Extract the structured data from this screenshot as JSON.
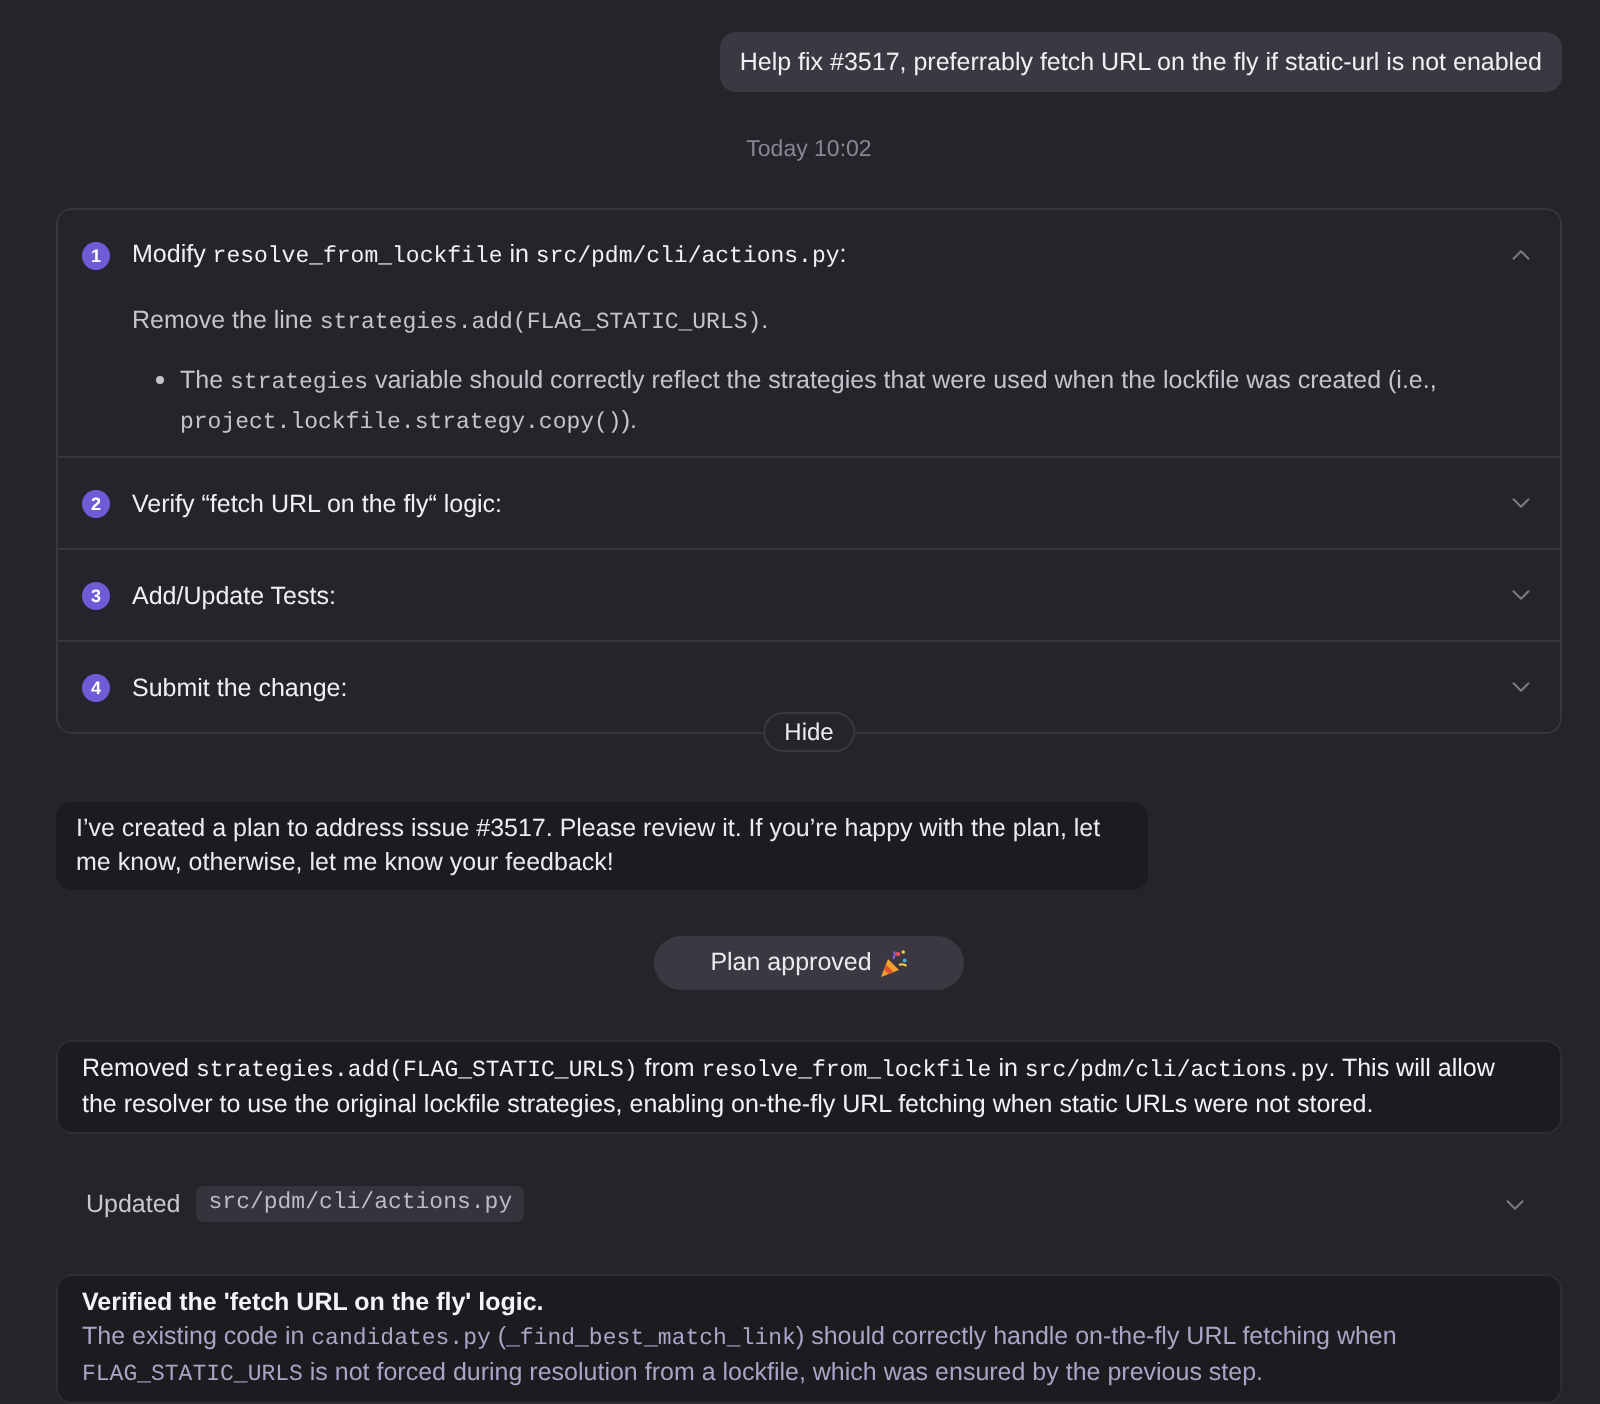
{
  "user_message": {
    "text": "Help fix #3517, preferrably fetch URL on the fly if static-url is not enabled"
  },
  "timestamp": "Today 10:02",
  "plan": {
    "steps": [
      {
        "number": "1",
        "expanded": true,
        "title": [
          {
            "text": "Modify ",
            "kind": "text"
          },
          {
            "text": "resolve_from_lockfile",
            "kind": "code"
          },
          {
            "text": " in ",
            "kind": "text"
          },
          {
            "text": "src/pdm/cli/actions.py",
            "kind": "code"
          },
          {
            "text": ":",
            "kind": "text"
          }
        ],
        "details": {
          "text": [
            {
              "text": "Remove the line ",
              "kind": "text"
            },
            {
              "text": "strategies.add(FLAG_STATIC_URLS)",
              "kind": "code"
            },
            {
              "text": ".",
              "kind": "text"
            }
          ],
          "bullets": [
            [
              {
                "text": "The ",
                "kind": "text"
              },
              {
                "text": "strategies",
                "kind": "code"
              },
              {
                "text": " variable should correctly reflect the strategies that were used when the lockfile was created (i.e., ",
                "kind": "text"
              },
              {
                "text": "project.lockfile.strategy.copy()",
                "kind": "code"
              },
              {
                "text": ").",
                "kind": "text"
              }
            ]
          ]
        }
      },
      {
        "number": "2",
        "expanded": false,
        "title": [
          {
            "text": "Verify “fetch URL on the fly“ logic:",
            "kind": "text"
          }
        ]
      },
      {
        "number": "3",
        "expanded": false,
        "title": [
          {
            "text": "Add/Update Tests:",
            "kind": "text"
          }
        ]
      },
      {
        "number": "4",
        "expanded": false,
        "title": [
          {
            "text": "Submit the change:",
            "kind": "text"
          }
        ]
      }
    ],
    "hide_button": "Hide"
  },
  "assistant_message": {
    "text": "I’ve created a plan to address issue #3517. Please review it. If you’re happy with the plan, let me know, otherwise, let me know your feedback!"
  },
  "approval": {
    "label": "Plan approved"
  },
  "summary": [
    {
      "text": "Removed ",
      "kind": "text"
    },
    {
      "text": "strategies.add(FLAG_STATIC_URLS)",
      "kind": "code"
    },
    {
      "text": " from ",
      "kind": "text"
    },
    {
      "text": "resolve_from_lockfile",
      "kind": "code"
    },
    {
      "text": " in ",
      "kind": "text"
    },
    {
      "text": "src/pdm/cli/actions.py",
      "kind": "code"
    },
    {
      "text": ". This will allow the resolver to use the original lockfile strategies, enabling on-the-fly URL fetching when static URLs were not stored.",
      "kind": "text"
    }
  ],
  "file_update": {
    "label": "Updated",
    "path": "src/pdm/cli/actions.py",
    "expanded": false
  },
  "verification": {
    "title": "Verified the 'fetch URL on the fly' logic.",
    "body": [
      {
        "text": "The existing code in ",
        "kind": "text"
      },
      {
        "text": "candidates.py",
        "kind": "code"
      },
      {
        "text": " (",
        "kind": "text"
      },
      {
        "text": "_find_best_match_link",
        "kind": "code"
      },
      {
        "text": ") should correctly handle on-the-fly URL fetching when ",
        "kind": "text"
      },
      {
        "text": "FLAG_STATIC_URLS",
        "kind": "code"
      },
      {
        "text": " is not forced during resolution from a lockfile, which was ensured by the previous step.",
        "kind": "text"
      }
    ]
  }
}
